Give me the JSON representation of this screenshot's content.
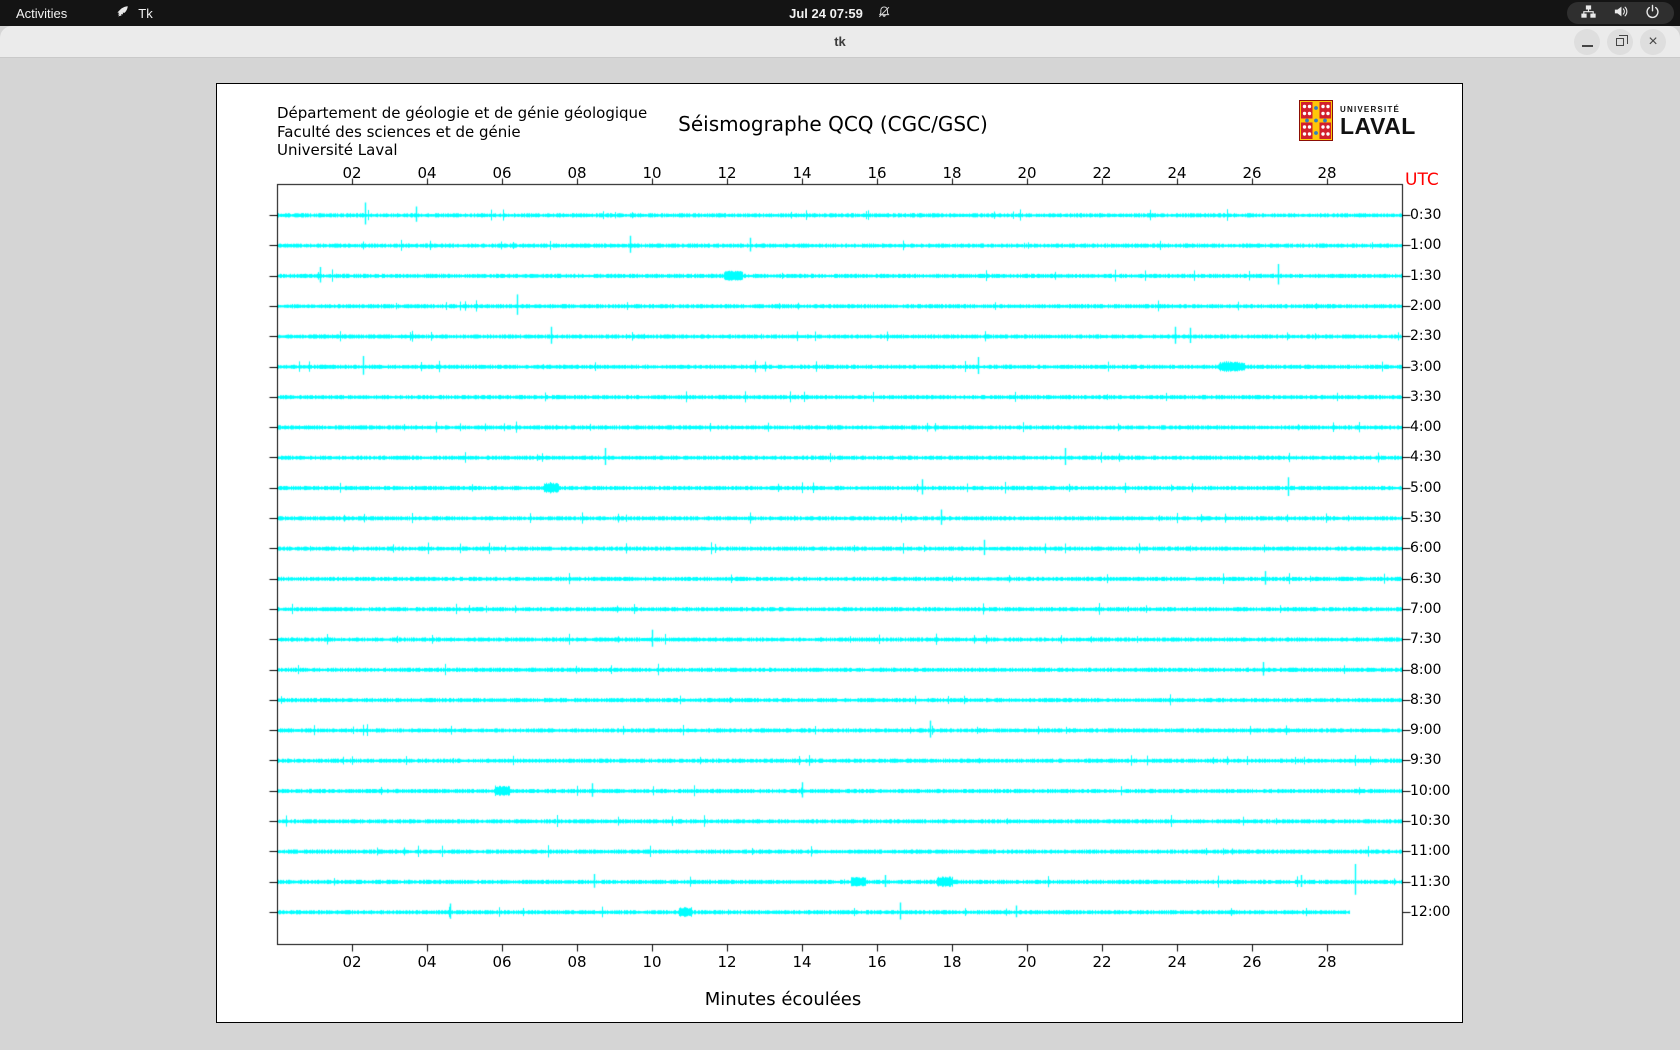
{
  "top_bar": {
    "activities": "Activities",
    "app_name": "Tk",
    "clock": "Jul 24 07:59",
    "icons": {
      "bell": "notifications-muted",
      "network": "network-wired",
      "volume": "audio-volume-high",
      "power": "system-power"
    }
  },
  "window": {
    "title": "tk"
  },
  "header": {
    "line1": "Département de géologie et de génie géologique",
    "line2": "Faculté des sciences et de génie",
    "line3": "Université Laval"
  },
  "logo": {
    "line1": "UNIVERSITÉ",
    "line2": "LAVAL"
  },
  "chart_data": {
    "type": "line",
    "subtype": "helicorder-seismogram",
    "title": "Séismographe QCQ (CGC/GSC)",
    "xlabel": "Minutes écoulées",
    "ylabel": "UTC",
    "x_ticks": [
      "02",
      "04",
      "06",
      "08",
      "10",
      "12",
      "14",
      "16",
      "18",
      "20",
      "22",
      "24",
      "26",
      "28"
    ],
    "x_range_minutes": [
      0,
      30
    ],
    "trace_color": "#00ffff",
    "utc_color": "#ff0000",
    "rows": [
      {
        "label": "0:30",
        "spikes": [
          [
            2.35,
            13
          ],
          [
            3.7,
            9
          ]
        ],
        "bursts": []
      },
      {
        "label": "1:00",
        "spikes": [
          [
            9.4,
            10
          ],
          [
            12.6,
            8
          ]
        ],
        "bursts": []
      },
      {
        "label": "1:30",
        "spikes": [
          [
            1.15,
            9
          ],
          [
            26.7,
            12
          ]
        ],
        "bursts": [
          [
            11.9,
            12.4
          ]
        ]
      },
      {
        "label": "2:00",
        "spikes": [
          [
            6.4,
            12
          ]
        ],
        "bursts": []
      },
      {
        "label": "2:30",
        "spikes": [
          [
            7.3,
            10
          ],
          [
            23.95,
            10
          ],
          [
            24.35,
            9
          ]
        ],
        "bursts": []
      },
      {
        "label": "3:00",
        "spikes": [
          [
            2.3,
            11
          ],
          [
            18.7,
            10
          ]
        ],
        "bursts": [
          [
            25.1,
            25.8
          ]
        ]
      },
      {
        "label": "3:30",
        "spikes": [],
        "bursts": []
      },
      {
        "label": "4:00",
        "spikes": [],
        "bursts": []
      },
      {
        "label": "4:30",
        "spikes": [
          [
            8.75,
            10
          ],
          [
            21.0,
            10
          ]
        ],
        "bursts": []
      },
      {
        "label": "5:00",
        "spikes": [
          [
            17.2,
            9
          ],
          [
            26.95,
            11
          ]
        ],
        "bursts": [
          [
            7.1,
            7.5
          ]
        ]
      },
      {
        "label": "5:30",
        "spikes": [
          [
            17.7,
            9
          ]
        ],
        "bursts": []
      },
      {
        "label": "6:00",
        "spikes": [
          [
            18.85,
            9
          ]
        ],
        "bursts": []
      },
      {
        "label": "6:30",
        "spikes": [
          [
            26.35,
            8
          ]
        ],
        "bursts": []
      },
      {
        "label": "7:00",
        "spikes": [],
        "bursts": []
      },
      {
        "label": "7:30",
        "spikes": [
          [
            10.0,
            10
          ]
        ],
        "bursts": []
      },
      {
        "label": "8:00",
        "spikes": [
          [
            26.3,
            8
          ]
        ],
        "bursts": []
      },
      {
        "label": "8:30",
        "spikes": [],
        "bursts": []
      },
      {
        "label": "9:00",
        "spikes": [
          [
            17.4,
            10
          ]
        ],
        "bursts": []
      },
      {
        "label": "9:30",
        "spikes": [],
        "bursts": []
      },
      {
        "label": "10:00",
        "spikes": [
          [
            8.4,
            8
          ],
          [
            14.0,
            9
          ]
        ],
        "bursts": [
          [
            5.8,
            6.2
          ]
        ]
      },
      {
        "label": "10:30",
        "spikes": [],
        "bursts": []
      },
      {
        "label": "11:00",
        "spikes": [],
        "bursts": []
      },
      {
        "label": "11:30",
        "spikes": [
          [
            8.45,
            8
          ],
          [
            16.2,
            7
          ],
          [
            27.3,
            7
          ],
          [
            28.75,
            18
          ]
        ],
        "bursts": [
          [
            15.3,
            15.7
          ],
          [
            17.6,
            18.0
          ]
        ]
      },
      {
        "label": "12:00",
        "spikes": [
          [
            4.6,
            9
          ],
          [
            16.6,
            10
          ],
          [
            19.7,
            7
          ]
        ],
        "bursts": [
          [
            10.7,
            11.05
          ]
        ],
        "end": 28.6
      }
    ]
  }
}
